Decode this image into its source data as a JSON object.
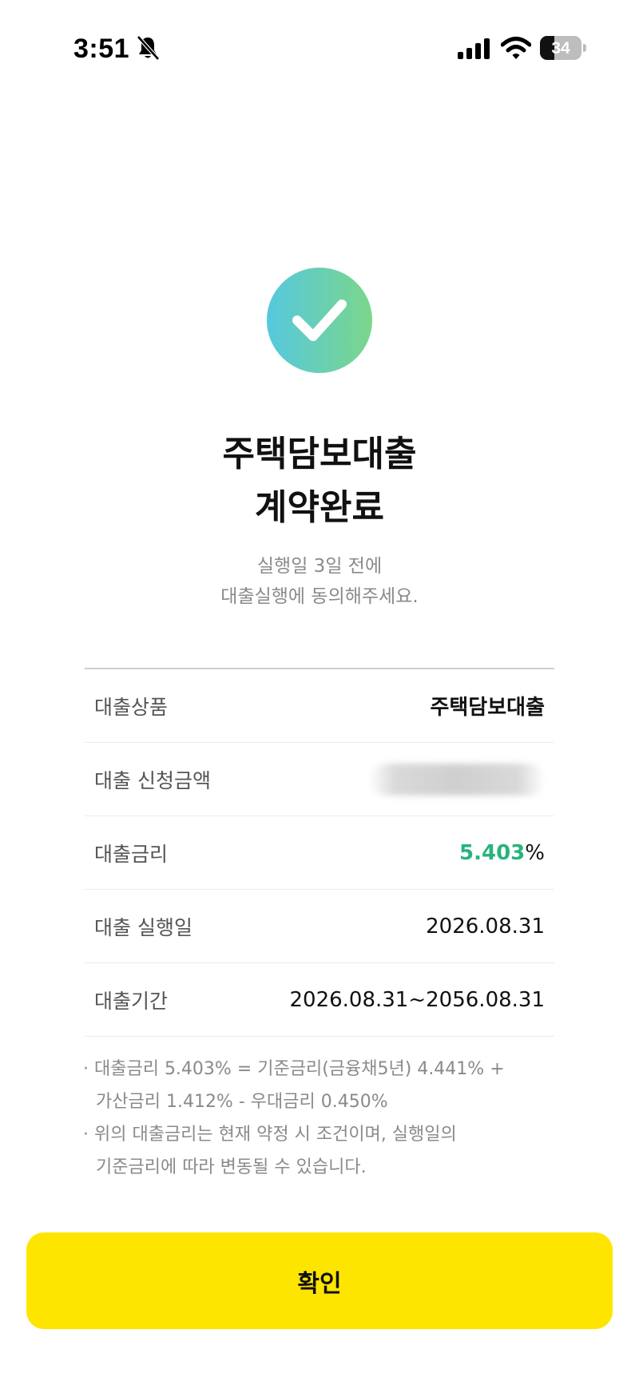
{
  "status_bar": {
    "time": "3:51",
    "battery_level": "34",
    "icons": [
      "bell-muted-icon",
      "cellular-signal-icon",
      "wifi-icon",
      "battery-icon"
    ]
  },
  "success_icon": "checkmark-circle-icon",
  "colors": {
    "accent_yellow": "#fee500",
    "rate_green": "#27b47a",
    "icon_gradient_start": "#56c8de",
    "icon_gradient_end": "#7bd68a"
  },
  "header": {
    "title_line1": "주택담보대출",
    "title_line2": "계약완료",
    "subtitle_line1": "실행일 3일 전에",
    "subtitle_line2": "대출실행에 동의해주세요."
  },
  "info": {
    "product": {
      "label": "대출상품",
      "value": "주택담보대출"
    },
    "amount": {
      "label": "대출 신청금액"
    },
    "rate": {
      "label": "대출금리",
      "value": "5.403",
      "unit": "%"
    },
    "execution_date": {
      "label": "대출 실행일",
      "value": "2026.08.31"
    },
    "term": {
      "label": "대출기간",
      "value": "2026.08.31~2056.08.31"
    }
  },
  "notes": {
    "line1": "· 대출금리 5.403% = 기준금리(금융채5년) 4.441% +",
    "line2": "가산금리 1.412% - 우대금리 0.450%",
    "line3": "· 위의 대출금리는 현재 약정 시 조건이며, 실행일의",
    "line4": "기준금리에 따라 변동될 수 있습니다."
  },
  "confirm_button": {
    "label": "확인"
  }
}
